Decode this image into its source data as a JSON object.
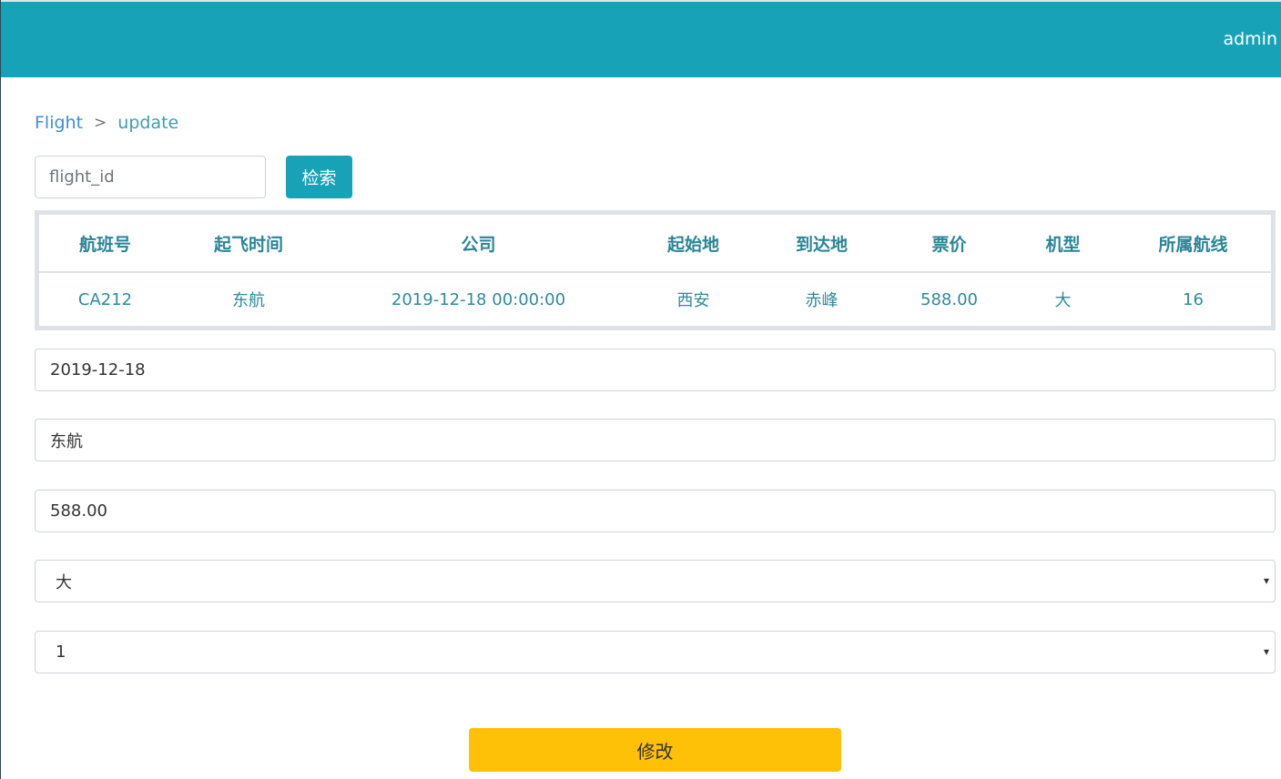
{
  "header": {
    "user_label": "admin",
    "bg_color": "#17a2b8"
  },
  "breadcrumb": {
    "items": [
      "Flight",
      "update"
    ],
    "separator": ">"
  },
  "search": {
    "placeholder": "flight_id",
    "value": "",
    "button_label": "检索"
  },
  "table": {
    "columns": [
      "航班号",
      "起飞时间",
      "公司",
      "起始地",
      "到达地",
      "票价",
      "机型",
      "所属航线"
    ],
    "rows": [
      [
        "CA212",
        "东航",
        "2019-12-18 00:00:00",
        "西安",
        "赤峰",
        "588.00",
        "大",
        "16"
      ]
    ]
  },
  "form": {
    "date_value": "2019-12-18",
    "company_value": "东航",
    "price_value": "588.00",
    "plane_type_selected": "大",
    "route_selected": "1",
    "submit_label": "修改",
    "submit_color": "#ffc107"
  },
  "icons": {
    "select_caret": "▾"
  }
}
